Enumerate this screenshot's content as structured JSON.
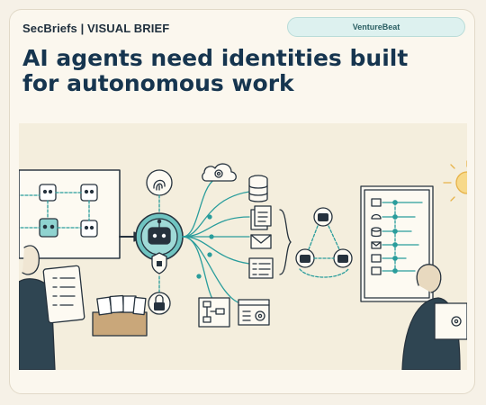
{
  "header": {
    "brand_label": "SecBriefs | VISUAL BRIEF",
    "source_label": "VentureBeat",
    "headline": "AI agents need identities built for autonomous work"
  },
  "illustration": {
    "icons": [
      "robot-icon",
      "fingerprint-icon",
      "cloud-icon",
      "database-icon",
      "document-icon",
      "mail-icon",
      "dashboard-icon",
      "padlock-icon",
      "shield-icon",
      "workflow-icon",
      "settings-icon",
      "checklist-icon",
      "card-file-icon",
      "gear-icon",
      "sun-icon"
    ]
  },
  "colors": {
    "accent": "#2a9d9c",
    "ink": "#16354f",
    "paper": "#fbf7ee"
  }
}
